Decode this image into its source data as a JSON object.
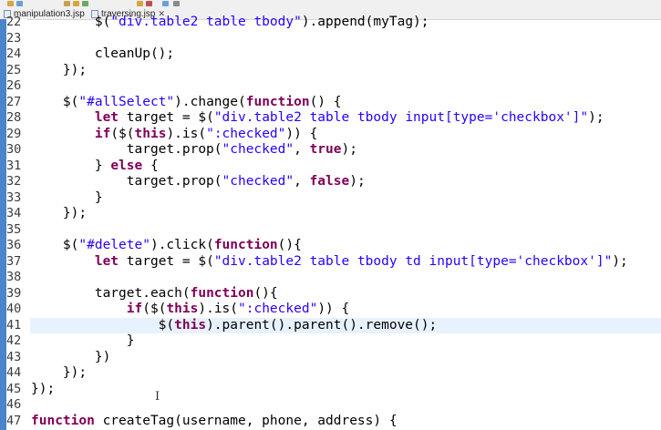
{
  "tabs": [
    {
      "label": "manipulation3.jsp"
    },
    {
      "label": "traversing.jsp",
      "close": "✕"
    }
  ],
  "code_lines": [
    {
      "n": "22",
      "html": "        $(<span class='s'>\"div.table2 table tbody\"</span>).append(myTag);"
    },
    {
      "n": "23",
      "html": ""
    },
    {
      "n": "24",
      "html": "        cleanUp();"
    },
    {
      "n": "25",
      "html": "    });"
    },
    {
      "n": "26",
      "html": ""
    },
    {
      "n": "27",
      "html": "    $(<span class='s'>\"#allSelect\"</span>).change(<span class='k'>function</span>() {"
    },
    {
      "n": "28",
      "html": "        <span class='k'>let</span> target = $(<span class='s'>\"div.table2 table tbody input[type='checkbox']\"</span>);"
    },
    {
      "n": "29",
      "html": "        <span class='k'>if</span>($(<span class='k'>this</span>).is(<span class='s'>\":checked\"</span>)) {"
    },
    {
      "n": "30",
      "html": "            target.prop(<span class='s'>\"checked\"</span>, <span class='k'>true</span>);"
    },
    {
      "n": "31",
      "html": "        } <span class='k'>else</span> {"
    },
    {
      "n": "32",
      "html": "            target.prop(<span class='s'>\"checked\"</span>, <span class='k'>false</span>);"
    },
    {
      "n": "33",
      "html": "        }"
    },
    {
      "n": "34",
      "html": "    });"
    },
    {
      "n": "35",
      "html": ""
    },
    {
      "n": "36",
      "html": "    $(<span class='s'>\"#delete\"</span>).click(<span class='k'>function</span>(){"
    },
    {
      "n": "37",
      "html": "        <span class='k'>let</span> target = $(<span class='s'>\"div.table2 table tbody td input[type='checkbox']\"</span>);"
    },
    {
      "n": "38",
      "html": ""
    },
    {
      "n": "39",
      "html": "        target.each(<span class='k'>function</span>(){"
    },
    {
      "n": "40",
      "html": "            <span class='k'>if</span>($(<span class='k'>this</span>).is(<span class='s'>\":checked\"</span>)) {"
    },
    {
      "n": "41",
      "html": "                $(<span class='k'>this</span>).parent().parent().remove();",
      "current": true
    },
    {
      "n": "42",
      "html": "            }"
    },
    {
      "n": "43",
      "html": "        })"
    },
    {
      "n": "44",
      "html": "    });"
    },
    {
      "n": "45",
      "html": "});"
    },
    {
      "n": "46",
      "html": ""
    },
    {
      "n": "47",
      "html": "<span class='k'>function</span> createTag(username, phone, address) {"
    }
  ],
  "colors": {
    "keyword": "#7f0055",
    "string": "#2a00ff",
    "current_line": "#e8f2fe",
    "ruler": "#4a84c9"
  }
}
